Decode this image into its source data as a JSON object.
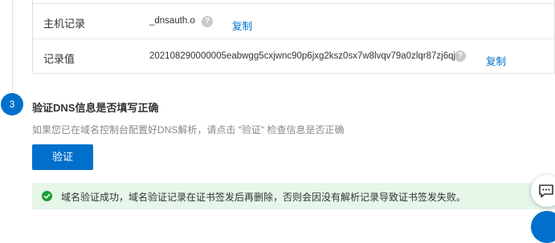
{
  "records": [
    {
      "label": "主机记录",
      "value": "_dnsauth.o",
      "copy": "复制"
    },
    {
      "label": "记录值",
      "value": "202108290000005eabwgg5cxjwnc90p6jxg2ksz0sx7w8lvqv79a0zlqr87zj6qj",
      "copy": "复制"
    }
  ],
  "step": {
    "number": "3",
    "title": "验证DNS信息是否填写正确",
    "description": "如果您已在域名控制台配置好DNS解析，请点击 \"验证\" 检查信息是否正确",
    "button": "验证"
  },
  "success_message": "域名验证成功，域名验证记录在证书签发后再删除，否则会因没有解析记录导致证书签发失败。",
  "help_glyph": "?",
  "colors": {
    "accent": "#0070cc",
    "success": "#1aa035",
    "success_bg": "#e6f6e9"
  }
}
